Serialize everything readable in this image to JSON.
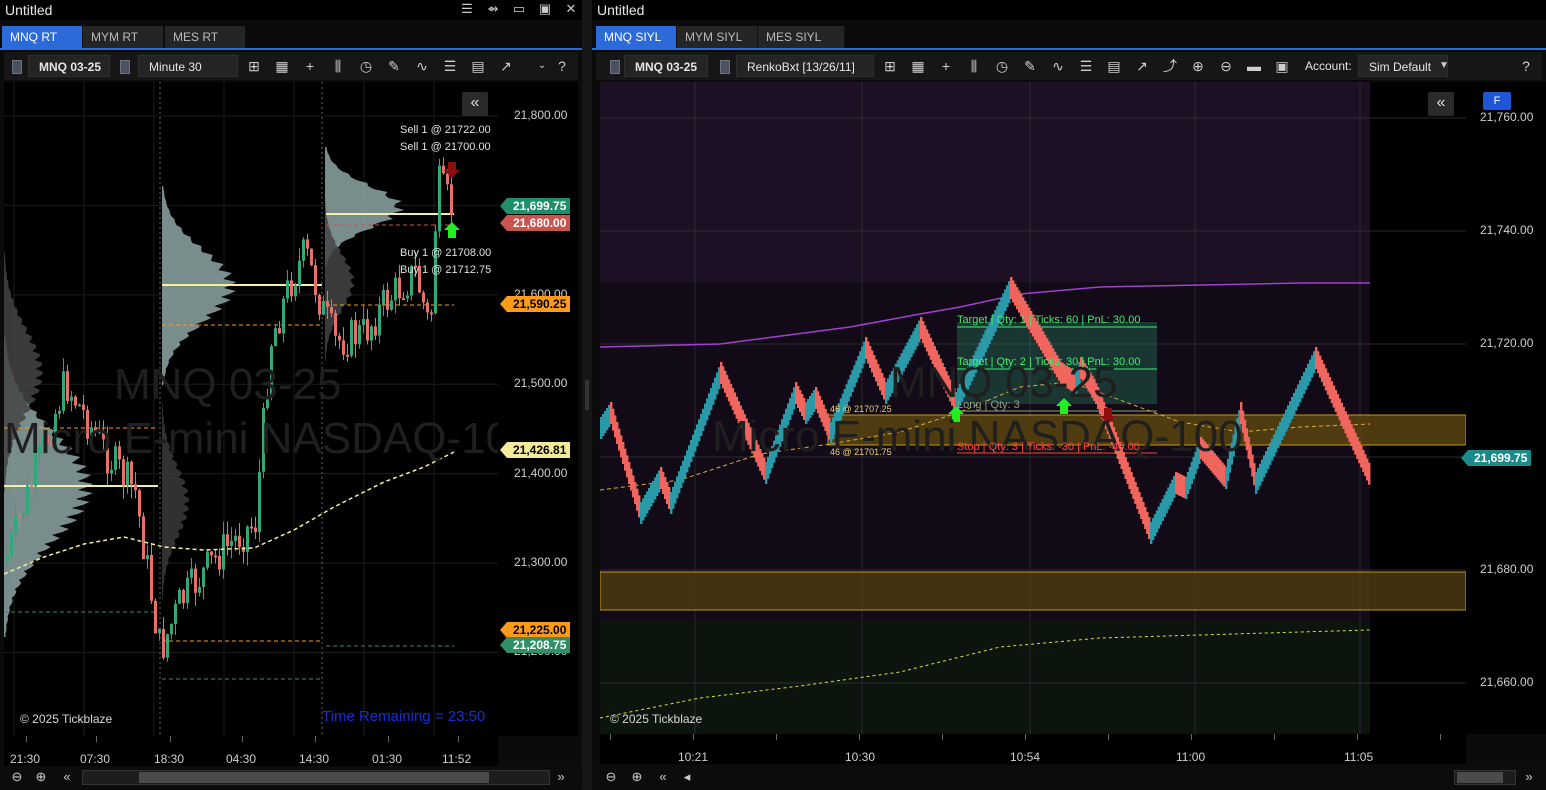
{
  "left": {
    "title": "Untitled",
    "window_buttons": [
      "☰",
      "⇴",
      "▭",
      "▣",
      "✕"
    ],
    "tabs": [
      {
        "label": "MNQ RT",
        "active": true
      },
      {
        "label": "MYM RT",
        "active": false
      },
      {
        "label": "MES RT",
        "active": false
      }
    ],
    "toolbar": {
      "instrument": "MNQ 03-25",
      "interval": "Minute 30",
      "help": "?"
    },
    "prices": [
      {
        "text": "21,800.00",
        "value": 21800
      },
      {
        "text": "21,600.00",
        "value": 21600
      },
      {
        "text": "21,500.00",
        "value": 21500
      },
      {
        "text": "21,400.00",
        "value": 21400
      },
      {
        "text": "21,300.00",
        "value": 21300
      },
      {
        "text": "21,200.00",
        "value": 21200
      }
    ],
    "tags": [
      {
        "text": "21,699.75",
        "value": 21699.75,
        "color": "#1f8f6b",
        "fg": "#ffffff"
      },
      {
        "text": "21,680.00",
        "value": 21680,
        "color": "#c9534f",
        "fg": "#ffffff"
      },
      {
        "text": "21,590.25",
        "value": 21590.25,
        "color": "#ff9a1a",
        "fg": "#000000"
      },
      {
        "text": "21,426.81",
        "value": 21426.81,
        "color": "#f3ea9a",
        "fg": "#000000"
      },
      {
        "text": "21,225.00",
        "value": 21225,
        "color": "#ff9a1a",
        "fg": "#000000"
      },
      {
        "text": "21,208.75",
        "value": 21208.75,
        "color": "#2f8f67",
        "fg": "#ffffff"
      }
    ],
    "times": [
      "21:30",
      "07:30",
      "18:30",
      "04:30",
      "14:30",
      "01:30",
      "11:52"
    ],
    "orders": [
      "Sell 1 @ 21722.00",
      "Sell 1 @ 21700.00",
      "Buy 1 @ 21708.00",
      "Buy 1 @ 21712.75"
    ],
    "watermark_line1": "MNQ 03-25",
    "watermark_line2": "Micro E-mini NASDAQ-100",
    "copyright": "© 2025 Tickblaze",
    "time_remaining": "Time Remaining = 23:50",
    "collapse_icon": "«"
  },
  "right": {
    "title": "Untitled",
    "tabs": [
      {
        "label": "MNQ SIYL",
        "active": true
      },
      {
        "label": "MYM SIYL",
        "active": false
      },
      {
        "label": "MES SIYL",
        "active": false
      }
    ],
    "toolbar": {
      "instrument": "MNQ 03-25",
      "interval": "RenkoBxt [13/26/11]",
      "account_label": "Account:",
      "account_value": "Sim Default",
      "help": "?"
    },
    "prices": [
      {
        "text": "21,760.00",
        "value": 21760
      },
      {
        "text": "21,740.00",
        "value": 21740
      },
      {
        "text": "21,720.00",
        "value": 21720
      },
      {
        "text": "21,680.00",
        "value": 21680
      },
      {
        "text": "21,660.00",
        "value": 21660
      }
    ],
    "tag": {
      "text": "21,699.75",
      "value": 21699.75,
      "color": "#1a8a8a",
      "fg": "#ffffff"
    },
    "times": [
      "10:21",
      "10:30",
      "10:54",
      "11:00",
      "11:05"
    ],
    "orders": {
      "target1": "Target | Qty: 1 | Ticks: 60 | PnL: 30.00",
      "target2": "Target | Qty: 2 | Ticks: 30 | PnL: 30.00",
      "long": "Long | Qty: 3",
      "stop": "Stop | Qty: 3 | Ticks: -30 | PnL: -45.00",
      "zone_top": "46 @ 21707.25",
      "zone_bottom": "46 @ 21701.75"
    },
    "watermark_line1": "MNQ 03-25",
    "watermark_line2": "Micro E-mini NASDAQ-100",
    "copyright": "© 2025 Tickblaze",
    "f_button": "F",
    "collapse_icon": "«"
  }
}
